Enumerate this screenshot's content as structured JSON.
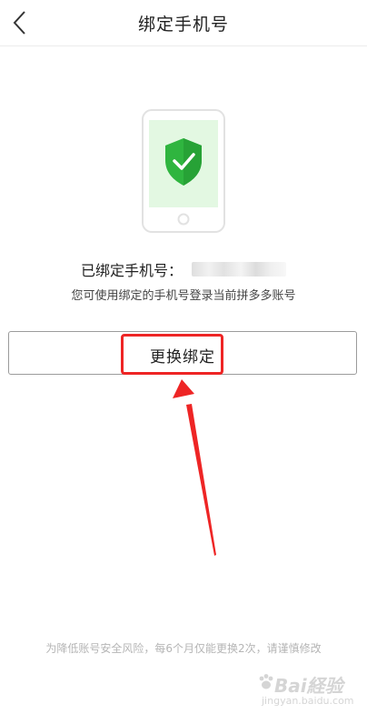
{
  "header": {
    "title": "绑定手机号",
    "back_icon": "chevron-left-icon"
  },
  "illustration": {
    "icon": "phone-shield-check-icon",
    "shield_color": "#2fb53f",
    "screen_color": "#e3f8e2"
  },
  "bound_phone": {
    "label": "已绑定手机号：",
    "hint": "您可使用绑定的手机号登录当前拼多多账号"
  },
  "actions": {
    "change_binding_label": "更换绑定"
  },
  "annotation": {
    "highlight_color": "#ee2525"
  },
  "footer": {
    "note": "为降低账号安全风险，每6个月仅能更换2次，请谨慎修改"
  },
  "watermark": {
    "brand": "Bai経验",
    "sub": "jingyan.baidu.com"
  }
}
